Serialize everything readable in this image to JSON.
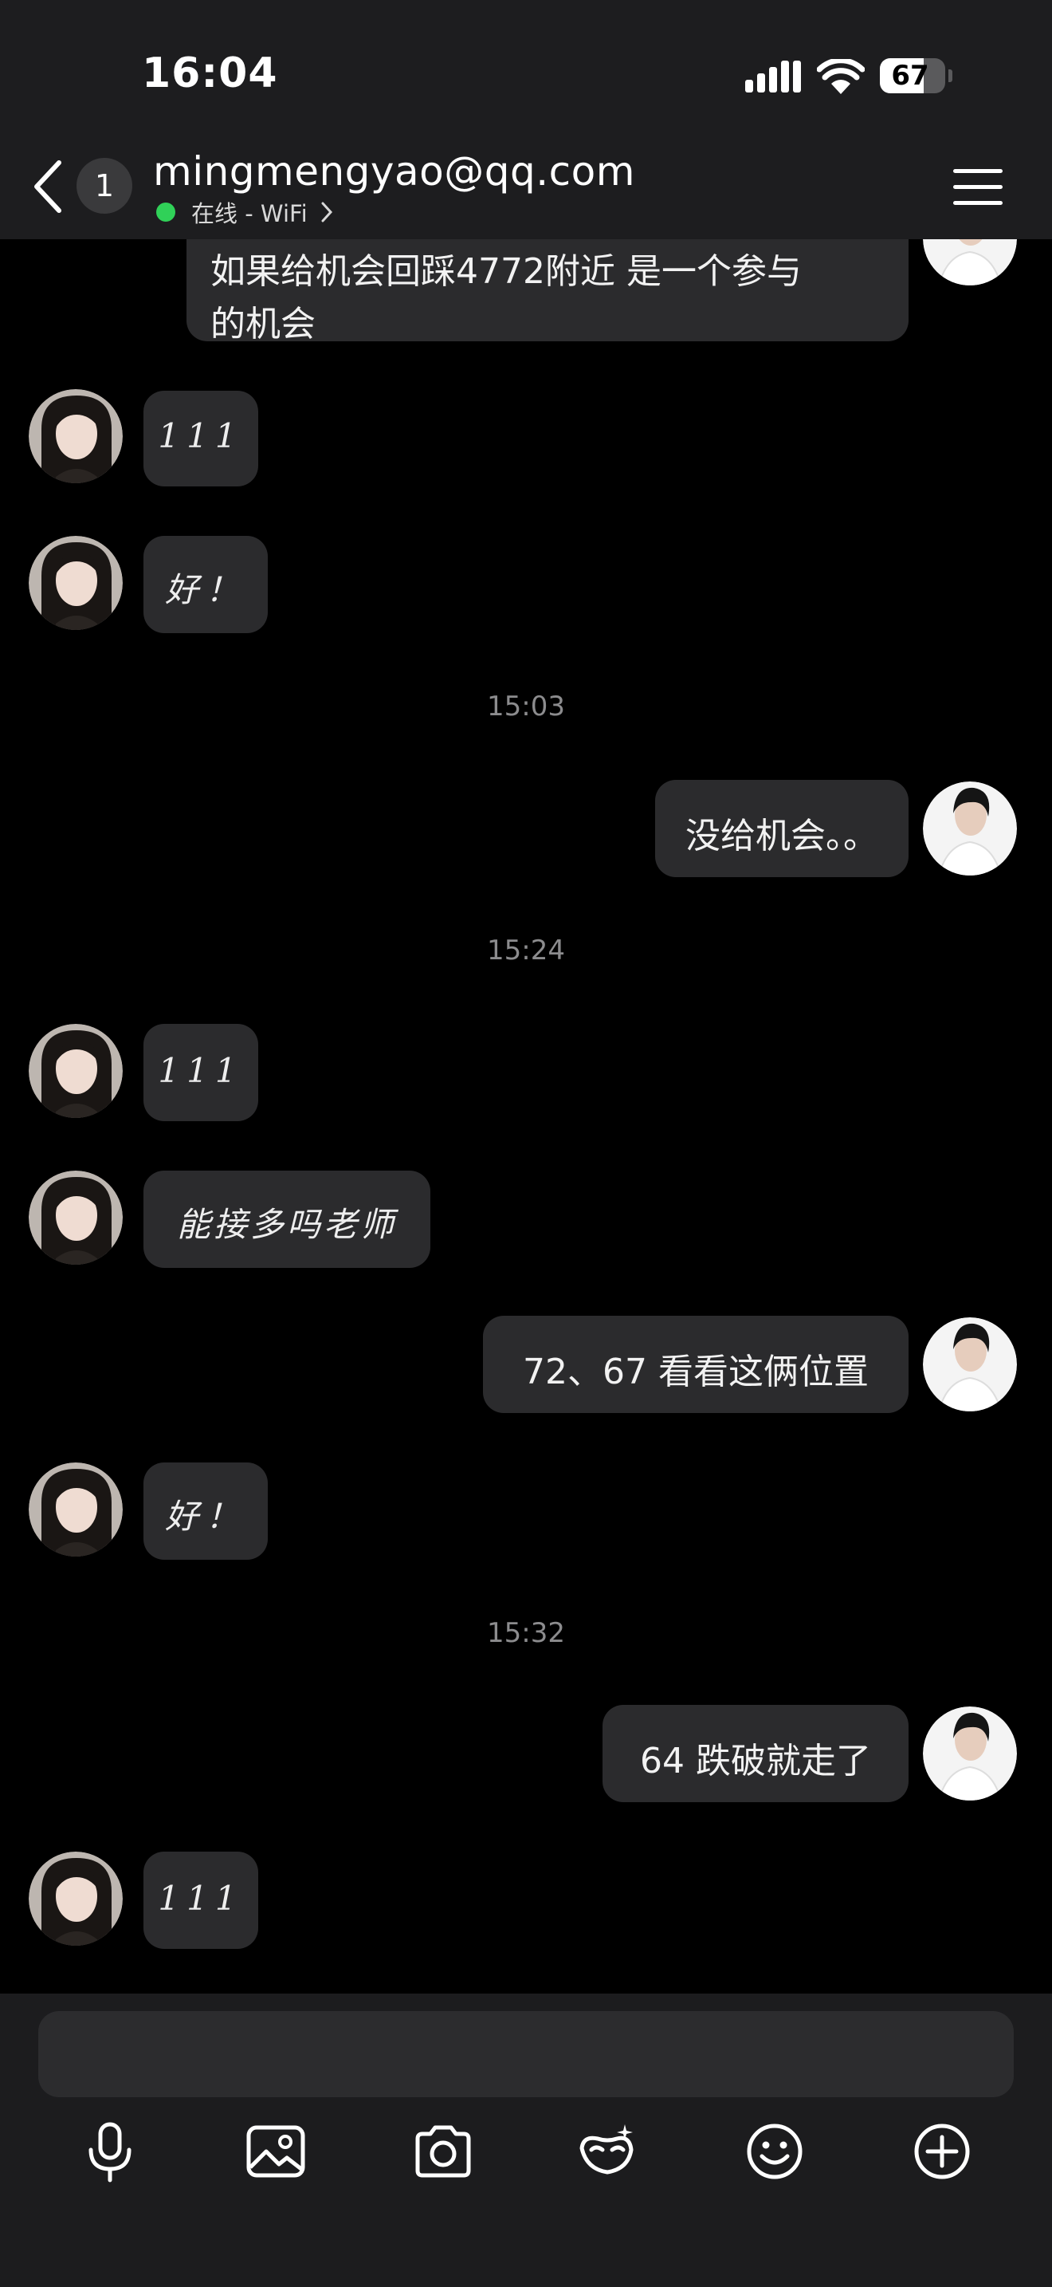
{
  "status_bar": {
    "time": "16:04",
    "battery": "67",
    "battery_percent": 67
  },
  "header": {
    "unread_count": "1",
    "contact": "mingmengyao@qq.com",
    "online_status": "在线 - WiFi"
  },
  "messages": [
    {
      "type": "out",
      "text_line1": "如果给机会回踩4772附近 是一个参与",
      "text_line2": "的机会"
    },
    {
      "type": "in",
      "text": "111"
    },
    {
      "type": "in",
      "text": "好！"
    },
    {
      "type": "time",
      "text": "15:03"
    },
    {
      "type": "out",
      "text": "没给机会。。"
    },
    {
      "type": "time",
      "text": "15:24"
    },
    {
      "type": "in",
      "text": "111"
    },
    {
      "type": "in",
      "text": "能接多吗老师"
    },
    {
      "type": "out",
      "text": "72、67 看看这俩位置"
    },
    {
      "type": "in",
      "text": "好！"
    },
    {
      "type": "time",
      "text": "15:32"
    },
    {
      "type": "out",
      "text": "64 跌破就走了"
    },
    {
      "type": "in",
      "text": "111"
    }
  ],
  "input": {
    "placeholder": "",
    "value": ""
  },
  "toolbar": [
    "microphone-icon",
    "image-icon",
    "camera-icon",
    "mask-icon",
    "emoji-icon",
    "plus-icon"
  ],
  "colors": {
    "background": "#000000",
    "header": "#1d1d1f",
    "bubble": "#2b2b2d",
    "online": "#30d158",
    "timestamp": "#8c8c8e"
  }
}
